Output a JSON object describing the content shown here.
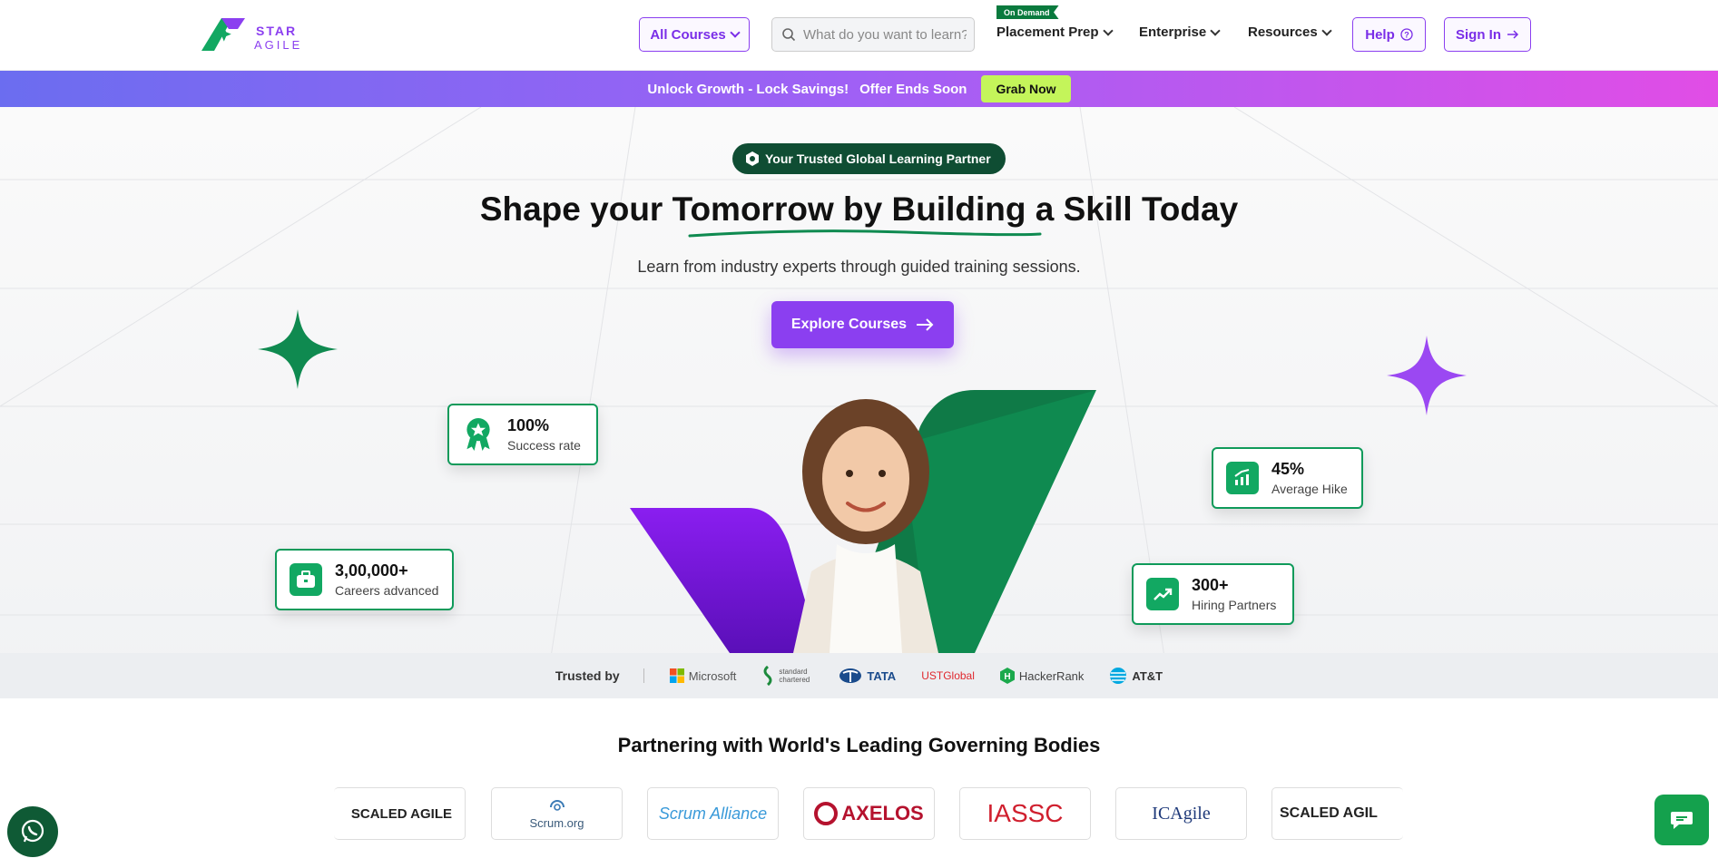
{
  "header": {
    "logo_line1": "STAR",
    "logo_line2": "AGILE",
    "all_courses": "All Courses",
    "search_placeholder": "What do you want to learn?",
    "on_demand_badge": "On Demand",
    "nav": [
      {
        "label": "Placement Prep"
      },
      {
        "label": "Enterprise"
      },
      {
        "label": "Resources"
      }
    ],
    "help": "Help",
    "sign_in": "Sign In"
  },
  "promo": {
    "text1": "Unlock Growth - Lock Savings!",
    "text2": "Offer Ends Soon",
    "cta": "Grab Now"
  },
  "hero": {
    "trust_pill": "Your Trusted Global Learning Partner",
    "title": "Shape your Tomorrow by Building a Skill Today",
    "subtitle": "Learn from industry experts through guided training sessions.",
    "cta": "Explore Courses",
    "stats": [
      {
        "value": "100%",
        "label": "Success rate"
      },
      {
        "value": "3,00,000+",
        "label": "Careers advanced"
      },
      {
        "value": "45%",
        "label": "Average Hike"
      },
      {
        "value": "300+",
        "label": "Hiring Partners"
      }
    ]
  },
  "trusted": {
    "label": "Trusted by",
    "brands": [
      "Microsoft",
      "standard chartered",
      "TATA",
      "USTGlobal",
      "HackerRank",
      "AT&T"
    ]
  },
  "partners": {
    "title": "Partnering with World's Leading Governing Bodies",
    "logos": [
      "SCALED AGILE",
      "Scrum.org",
      "Scrum Alliance",
      "AXELOS",
      "IASSC",
      "ICAgile",
      "SCALED AGIL"
    ]
  },
  "colors": {
    "brand_purple": "#8b3ff0",
    "brand_green": "#0f9a5a",
    "promo_cta": "#c4f55a"
  }
}
